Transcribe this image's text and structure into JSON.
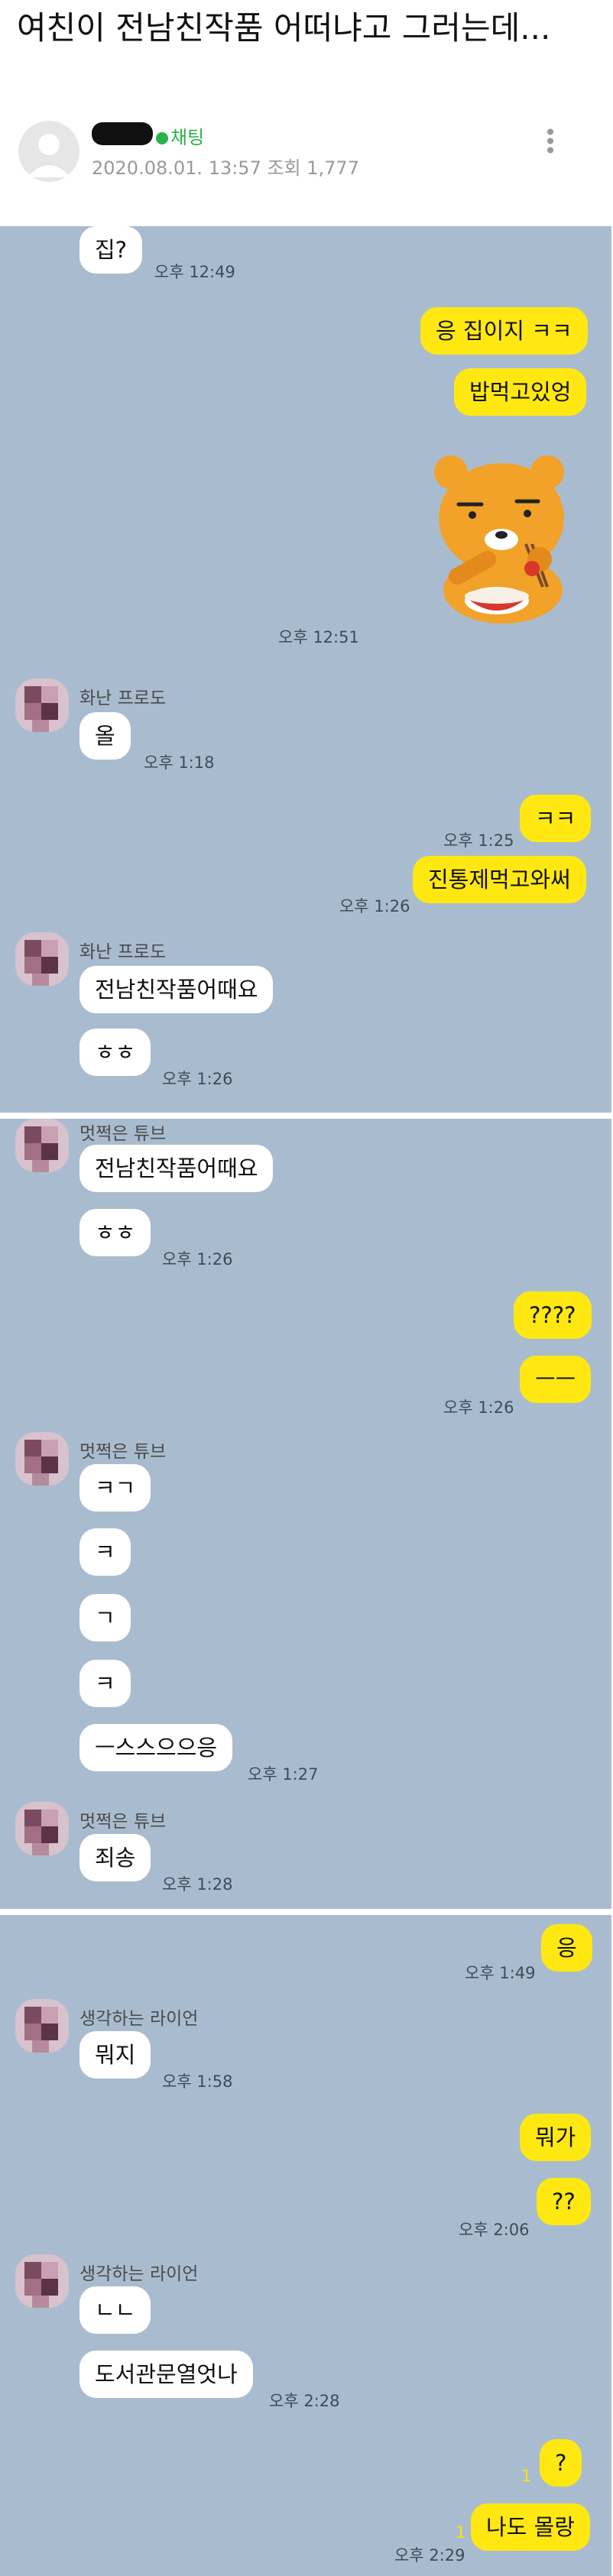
{
  "post": {
    "title": "여친이 전남친작품 어떠냐고 그러는데...",
    "channel_badge": "채팅",
    "info": "2020.08.01. 13:57 조회 1,777",
    "more_glyph": "⋮"
  },
  "names": {
    "hwanan_frodo": "화난 프로도",
    "cool_tube": "멋쩍은 튜브",
    "thinking_ryan": "생각하는 라이언"
  },
  "colors": {
    "chat_bg": "#a9bccf",
    "my_bubble": "#ffe812",
    "their_bubble": "#ffffff",
    "badge_green": "#2ab24b"
  },
  "icons": {
    "avatar": "default-user-icon",
    "sticker": "ryan-eating-sticker",
    "menu": "kebab-menu-icon"
  },
  "section1": {
    "m1": "집?",
    "t1": "오후 12:49",
    "m2": "응 집이지 ㅋㅋ",
    "m3": "밥먹고있엉",
    "t_sticker": "오후 12:51",
    "m4": "올",
    "t4": "오후 1:18",
    "m5": "ㅋㅋ",
    "t5": "오후 1:25",
    "m6": "진통제먹고와써",
    "t6": "오후 1:26",
    "m7": "전남친작품어때요",
    "m8": "ㅎㅎ",
    "t8": "오후 1:26"
  },
  "section2": {
    "m1": "전남친작품어때요",
    "m2": "ㅎㅎ",
    "t2": "오후 1:26",
    "m3": "????",
    "m4": "ㅡㅡ",
    "t4": "오후 1:26",
    "m5": "ㅋㄱ",
    "m6": "ㅋ",
    "m7": "ㄱ",
    "m8": "ㅋ",
    "m9": "ㅡ스스으으응",
    "t9": "오후 1:27",
    "m10": "죄송",
    "t10": "오후 1:28"
  },
  "section3": {
    "m1": "응",
    "t1": "오후 1:49",
    "m2": "뭐지",
    "t2": "오후 1:58",
    "m3": "뭐가",
    "m4": "??",
    "t4": "오후 2:06",
    "m5": "ㄴㄴ",
    "m6": "도서관문열엇나",
    "t6": "오후 2:28",
    "m7": "?",
    "u7": "1",
    "m8": "나도 몰랑",
    "u8": "1",
    "t8": "오후 2:29"
  }
}
